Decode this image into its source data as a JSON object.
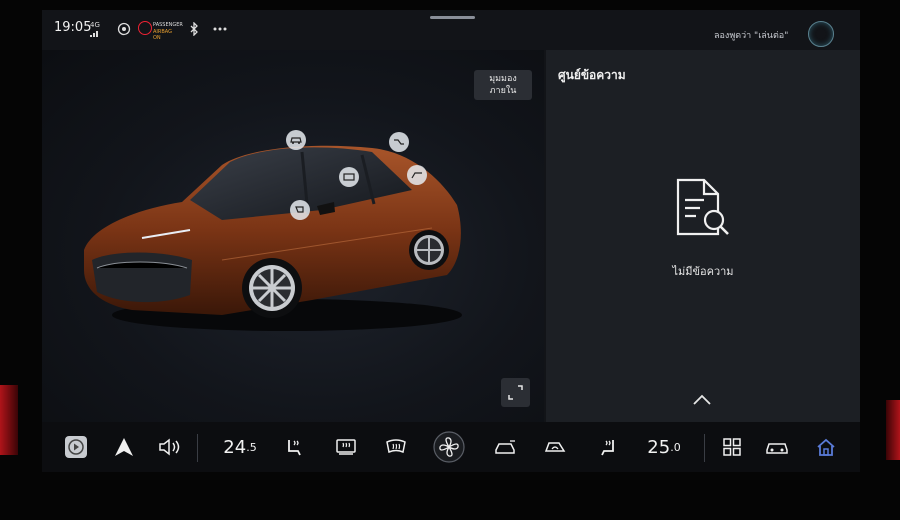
{
  "status_bar": {
    "time": "19:05",
    "signal_top": "4G",
    "airbag_label_line1": "PASSENGER",
    "airbag_label_line2": "AIRBAG ON",
    "voice_hint": "ลองพูดว่า \"เล่นต่อ\""
  },
  "car_view": {
    "view_button_line1": "มุมมอง",
    "view_button_line2": "ภายใน",
    "car_color": "#8a3f1a"
  },
  "message_center": {
    "title": "ศูนย์ข้อความ",
    "empty_text": "ไม่มีข้อความ"
  },
  "dock": {
    "driver_temp_main": "24",
    "driver_temp_decimal": ".5",
    "passenger_temp_main": "25",
    "passenger_temp_decimal": ".0"
  },
  "colors": {
    "accent_home": "#5a7bd8",
    "glow_red": "#b0141a"
  }
}
